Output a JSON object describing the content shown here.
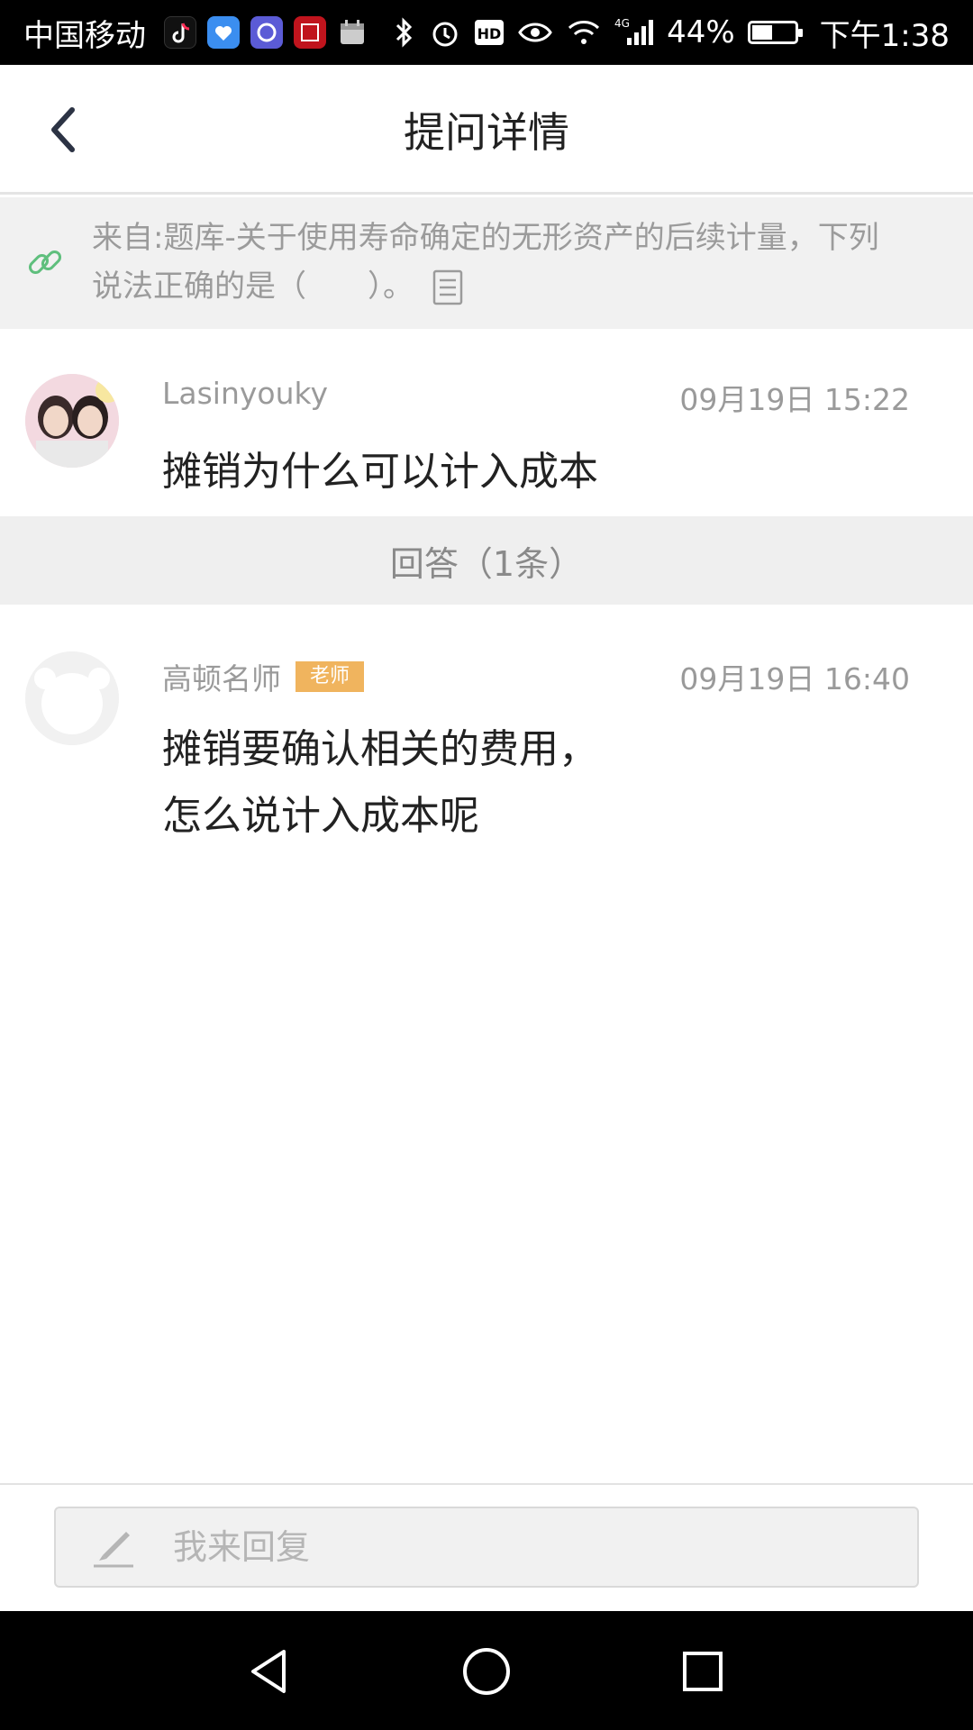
{
  "status_bar": {
    "carrier": "中国移动",
    "battery_percent": "44%",
    "time": "下午1:38",
    "network": "4G",
    "icons": [
      "tiktok-icon",
      "app-heart-icon",
      "app-swirl-icon",
      "app-news-icon",
      "calendar-icon",
      "bluetooth-icon",
      "alarm-icon",
      "hd-icon",
      "eye-icon",
      "wifi-icon",
      "signal-icon",
      "battery-icon"
    ]
  },
  "header": {
    "title": "提问详情",
    "back_icon": "chevron-left-icon"
  },
  "source": {
    "text": "来自:题库-关于使用寿命确定的无形资产的后续计量，下列说法正确的是（　　）。",
    "icon": "link-icon",
    "doc_icon": "document-icon"
  },
  "question": {
    "user": "Lasinyouky",
    "time": "09月19日  15:22",
    "text": "摊销为什么可以计入成本"
  },
  "answers": {
    "header": "回答（1条）",
    "items": [
      {
        "user": "高顿名师",
        "badge": "老师",
        "time": "09月19日  16:40",
        "line1": "摊销要确认相关的费用，",
        "line2": "怎么说计入成本呢"
      }
    ]
  },
  "reply": {
    "placeholder": "我来回复",
    "icon": "pen-icon"
  },
  "colors": {
    "badge": "#f0b45e",
    "accent_link": "#5fbf7d",
    "muted_text": "#9a9a9a",
    "banner_bg": "#f1f1f1"
  }
}
